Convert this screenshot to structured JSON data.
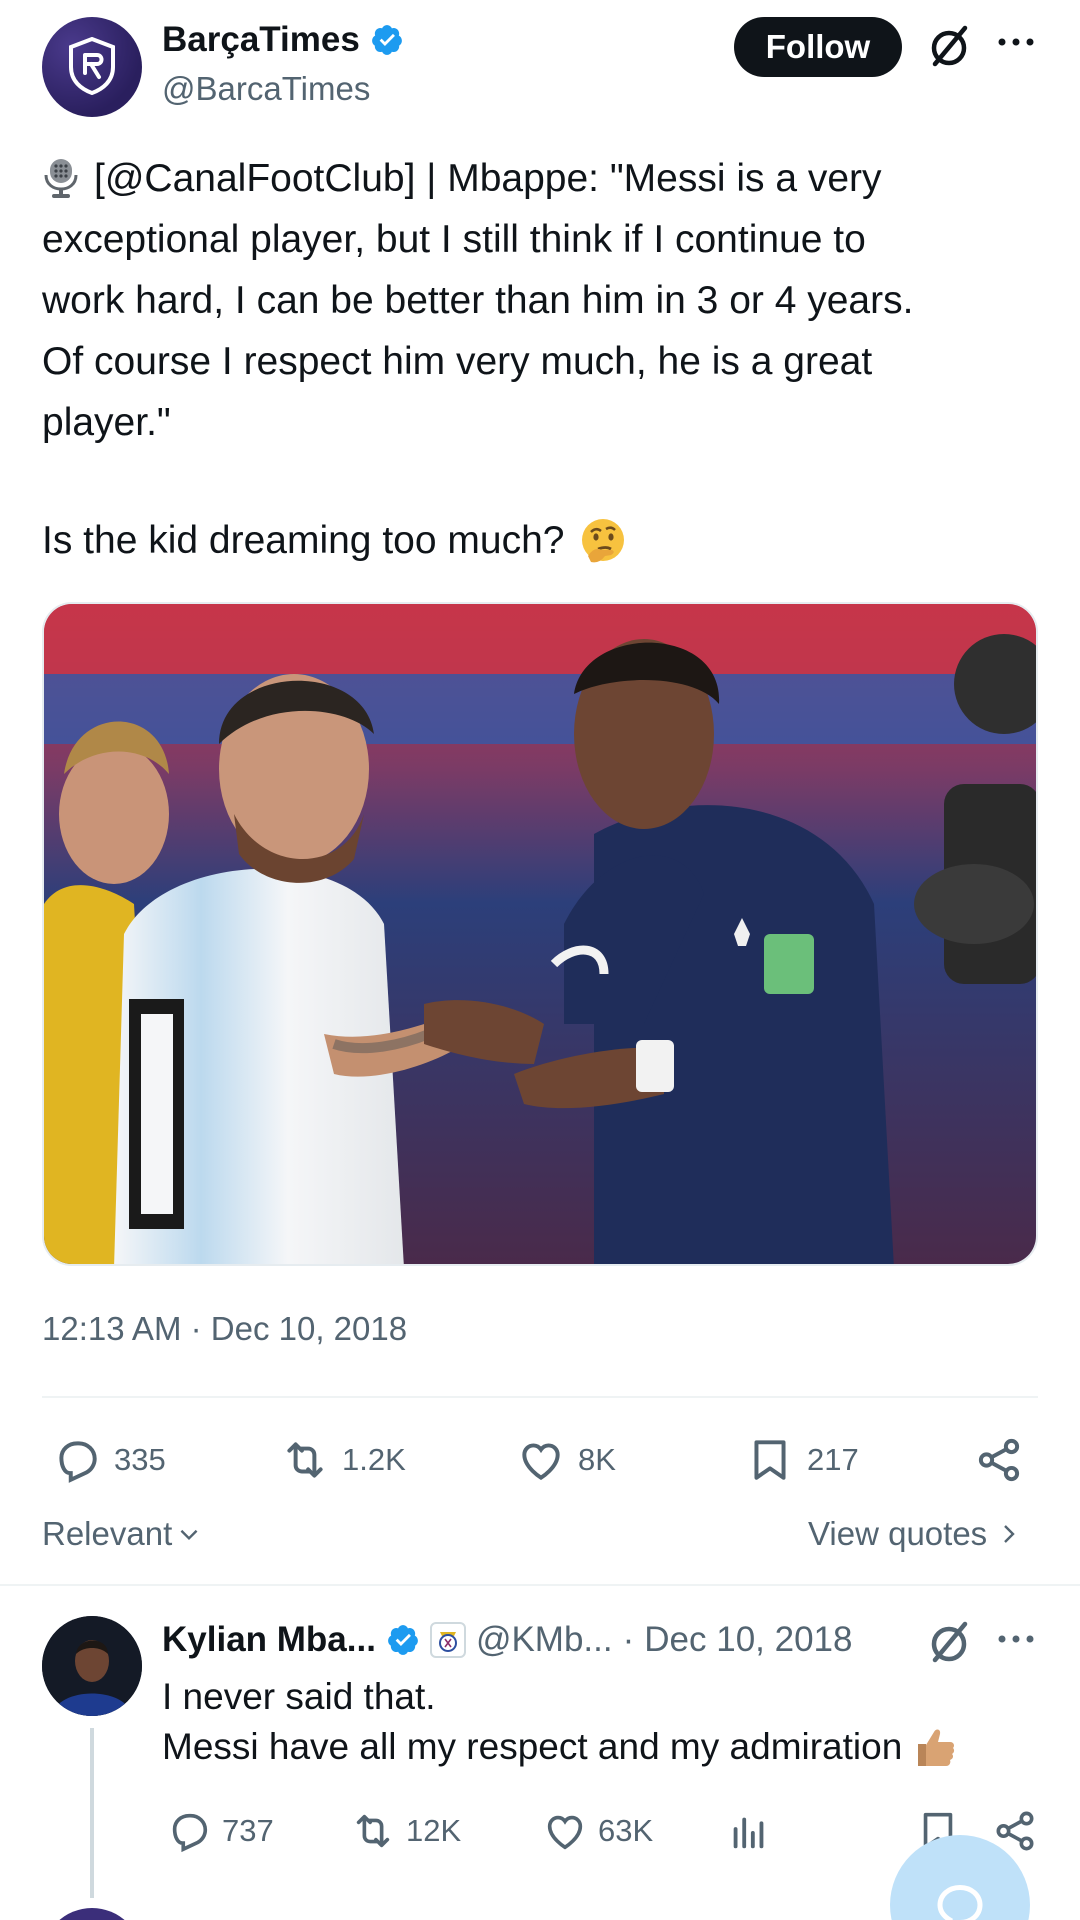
{
  "tweet": {
    "author_name": "BarçaTimes",
    "handle": "@BarcaTimes",
    "follow_label": "Follow",
    "text_lines": [
      "[@CanalFootClub] | Mbappe: \"Messi is a very",
      "exceptional player, but I still think if I continue to",
      "work hard, I can be better than him in 3 or 4 years.",
      "Of course I respect him very much, he is a great",
      "player.\""
    ],
    "question": "Is the kid dreaming too much?",
    "timestamp": "12:13 AM · Dec 10, 2018",
    "stats": {
      "replies": "335",
      "reposts": "1.2K",
      "likes": "8K",
      "bookmarks": "217"
    }
  },
  "filters": {
    "relevant_label": "Relevant",
    "view_quotes_label": "View quotes"
  },
  "reply": {
    "author_name": "Kylian Mba...",
    "handle": "@KMb...",
    "dot": "·",
    "date": "Dec 10, 2018",
    "line1": "I never said that.",
    "line2": "Messi have all my respect and my admiration",
    "stats": {
      "replies": "737",
      "reposts": "12K",
      "likes": "63K"
    }
  },
  "colors": {
    "text": "#0f1419",
    "secondary": "#536471",
    "verified": "#1d9bf0",
    "follow_bg": "#0f1419",
    "fab": "#bfe1f9"
  },
  "icons": [
    "verified-icon",
    "grok-icon",
    "more-icon",
    "microphone-emoji",
    "thinking-emoji",
    "reply-icon",
    "repost-icon",
    "like-icon",
    "bookmark-icon",
    "share-icon",
    "views-icon",
    "chevron-down-icon",
    "chevron-right-icon",
    "thumbs-up-emoji",
    "real-madrid-badge-icon",
    "compose-icon"
  ]
}
